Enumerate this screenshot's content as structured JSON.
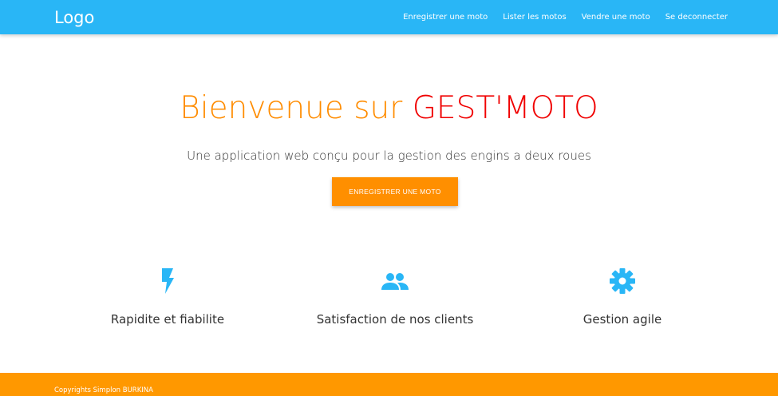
{
  "navbar": {
    "logo": "Logo",
    "links": [
      "Enregistrer une moto",
      "Lister les motos",
      "Vendre une moto",
      "Se deconnecter"
    ],
    "bg_color": "#29b6f6"
  },
  "hero": {
    "title_part1": "Bienvenue sur ",
    "title_part2": "GEST'MOTO",
    "title_part1_color": "#ff8c00",
    "title_part2_color": "#f00000",
    "subtitle": "Une application web conçu pour la gestion des engins a deux roues",
    "cta_label": "ENREGISTRER UNE MOTO",
    "cta_color": "#ff8f00"
  },
  "features": [
    {
      "icon": "flash-icon",
      "label": "Rapidite et fiabilite"
    },
    {
      "icon": "group-icon",
      "label": "Satisfaction de nos clients"
    },
    {
      "icon": "settings-icon",
      "label": "Gestion agile"
    }
  ],
  "accent_icon_color": "#29b6f6",
  "footer": {
    "text": "Copyrights Simplon BURKINA",
    "bg_color": "#ff9800"
  }
}
